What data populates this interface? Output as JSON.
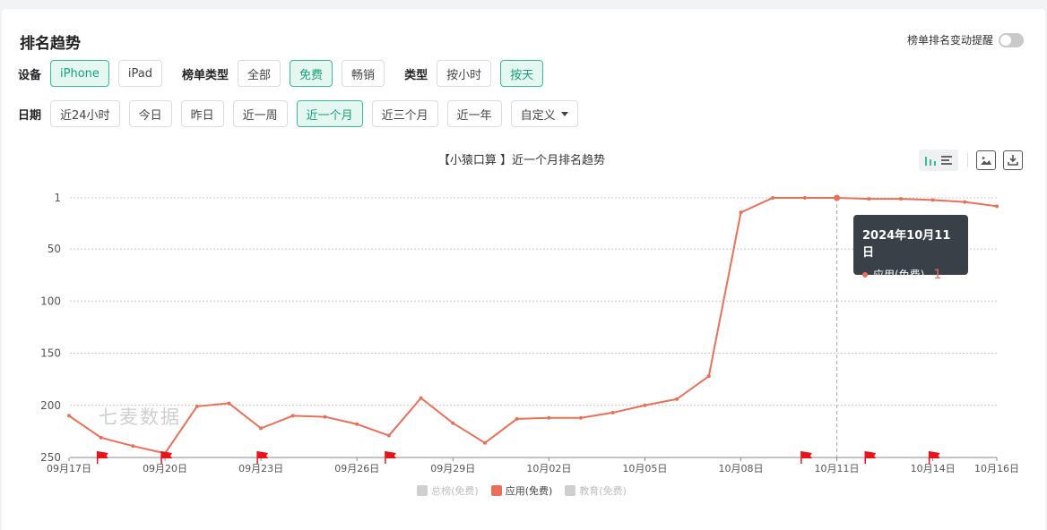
{
  "page": {
    "title": "排名趋势",
    "alert_toggle_label": "榜单排名变动提醒"
  },
  "filters": {
    "device": {
      "label": "设备",
      "options": [
        "iPhone",
        "iPad"
      ],
      "active": "iPhone"
    },
    "list_type": {
      "label": "榜单类型",
      "options": [
        "全部",
        "免费",
        "畅销"
      ],
      "active": "免费"
    },
    "granularity": {
      "label": "类型",
      "options": [
        "按小时",
        "按天"
      ],
      "active": "按天"
    },
    "date": {
      "label": "日期",
      "options": [
        "近24小时",
        "今日",
        "昨日",
        "近一周",
        "近一个月",
        "近三个月",
        "近一年"
      ],
      "active": "近一个月",
      "custom_label": "自定义"
    }
  },
  "tooltip": {
    "date": "2024年10月11日",
    "series": "应用(免费)",
    "value": "1"
  },
  "watermark": "七麦数据",
  "colors": {
    "accent": "#3dbb94",
    "line": "#e8705a",
    "flag": "#e8141c"
  },
  "chart_data": {
    "type": "line",
    "title": "【小猿口算 】近一个月排名趋势",
    "y_reversed": true,
    "ylim": [
      1,
      250
    ],
    "yticks": [
      1,
      50,
      100,
      150,
      200,
      250
    ],
    "xticks": [
      "09月17日",
      "09月20日",
      "09月23日",
      "09月26日",
      "09月29日",
      "10月02日",
      "10月05日",
      "10月08日",
      "10月11日",
      "10月14日",
      "10月16日"
    ],
    "x": [
      "09月17日",
      "09月18日",
      "09月19日",
      "09月20日",
      "09月21日",
      "09月22日",
      "09月23日",
      "09月24日",
      "09月25日",
      "09月26日",
      "09月27日",
      "09月28日",
      "09月29日",
      "09月30日",
      "10月01日",
      "10月02日",
      "10月03日",
      "10月04日",
      "10月05日",
      "10月06日",
      "10月07日",
      "10月08日",
      "10月09日",
      "10月10日",
      "10月11日",
      "10月12日",
      "10月13日",
      "10月14日",
      "10月15日",
      "10月16日"
    ],
    "series": [
      {
        "name": "应用(免费)",
        "values": [
          210,
          231,
          239,
          246,
          201,
          198,
          222,
          210,
          211,
          218,
          229,
          193,
          217,
          236,
          213,
          212,
          212,
          207,
          200,
          194,
          172,
          15,
          1,
          1,
          1,
          2,
          2,
          3,
          5,
          9
        ]
      }
    ],
    "legend": [
      "总榜(免费)",
      "应用(免费)",
      "教育(免费)"
    ],
    "legend_active": "应用(免费)",
    "legend_position": "bottom",
    "flags": [
      "09月18日",
      "09月20日",
      "09月23日",
      "09月27日",
      "10月10日",
      "10月12日",
      "10月14日"
    ],
    "grid": true,
    "crosshair": "10月11日"
  }
}
